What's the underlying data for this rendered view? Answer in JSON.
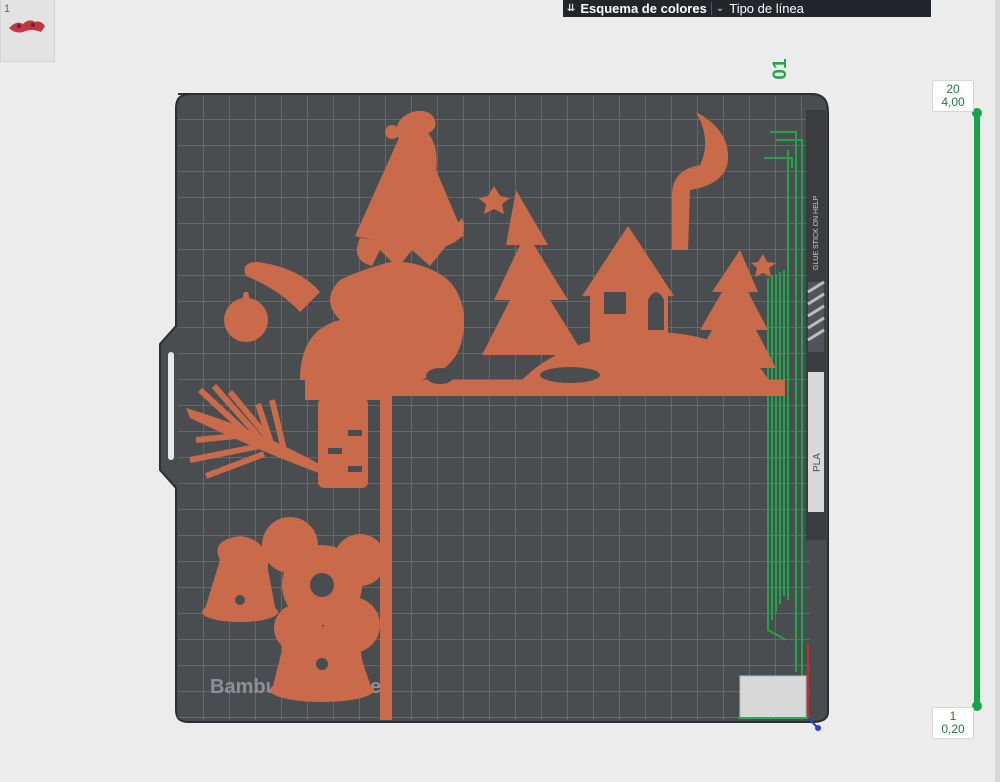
{
  "plate": {
    "index_label": "1",
    "number": "01",
    "brand_text": "Bambu Cool Plate",
    "side_note": "GLUE STICK ON HELP",
    "material": "PLA"
  },
  "toolbar": {
    "color_scheme_label": "Esquema de colores",
    "line_type_label": "Tipo de línea"
  },
  "layer_slider": {
    "top_layer": "20",
    "top_height": "4,00",
    "bottom_layer": "1",
    "bottom_height": "0,20"
  },
  "colors": {
    "plate": "#4a4d50",
    "model": "#c96a4a",
    "accent_green": "#16a34a",
    "toolbar_bg": "#22252a"
  }
}
